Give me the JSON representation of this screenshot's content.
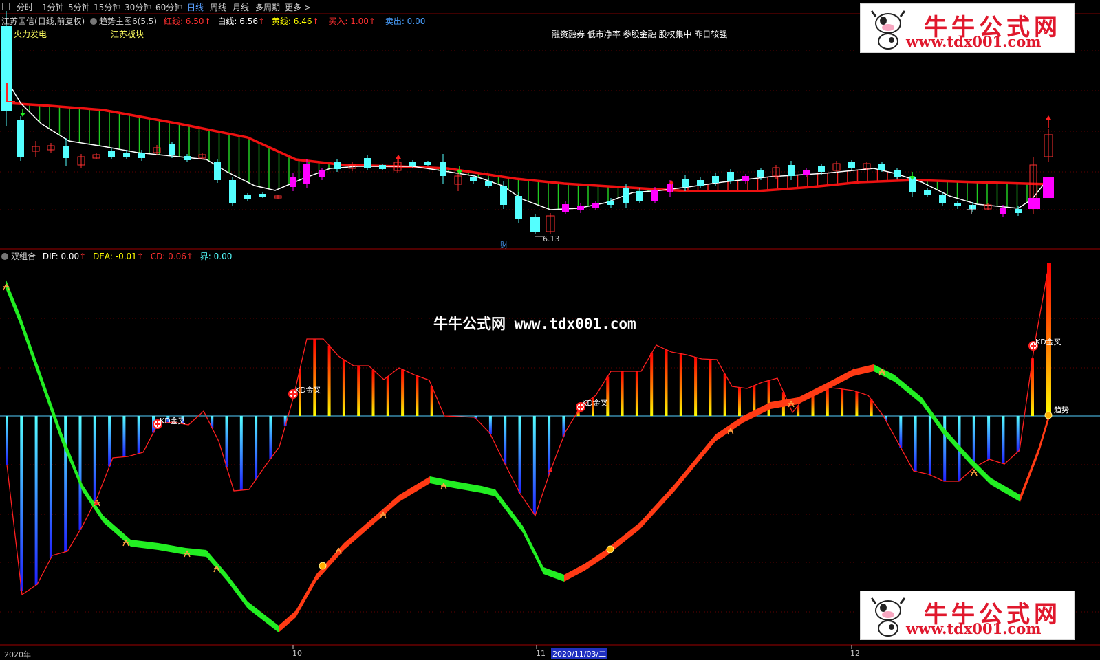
{
  "toolbar": {
    "tabs": [
      "分时",
      "1分钟",
      "5分钟",
      "15分钟",
      "30分钟",
      "60分钟",
      "日线",
      "周线",
      "月线",
      "多周期",
      "更多 >"
    ],
    "active": "日线"
  },
  "upper": {
    "stock": "江苏国信",
    "mode": "(日线,前复权)",
    "indicator": "趋势主图6(5,5)",
    "red_line": "红线: 6.50",
    "white_line": "白线: 6.56",
    "yellow_line": "黄线: 6.46",
    "buy": "买入: 1.00",
    "sell": "卖出: 0.00",
    "tag_left": "火力发电",
    "tag_sector": "江苏板块",
    "tags_right": "融资融券 低市净率 参股金融 股权集中 昨日较强",
    "low_price": "6.13",
    "cai": "财"
  },
  "lower": {
    "indicator": "双组合",
    "dif": "DIF: 0.00",
    "dea": "DEA: -0.01",
    "cd": "CD: 0.06",
    "jie": "界: 0.00",
    "kd_label": "KD金叉",
    "trend_label": "趋势",
    "watermark": "牛牛公式网 www.tdx001.com"
  },
  "xaxis": {
    "year": "2020年",
    "m10": "10",
    "m11": "11",
    "cursor_date": "2020/11/03/二",
    "m12": "12"
  },
  "logo": {
    "name": "牛牛公式网",
    "url": "www.tdx001.com"
  },
  "colors": {
    "background": "#000000",
    "red": "#ff2020",
    "cyan": "#54ffff",
    "magenta": "#ff00ff",
    "green": "#22ee22",
    "yellow": "#ffff00"
  }
}
